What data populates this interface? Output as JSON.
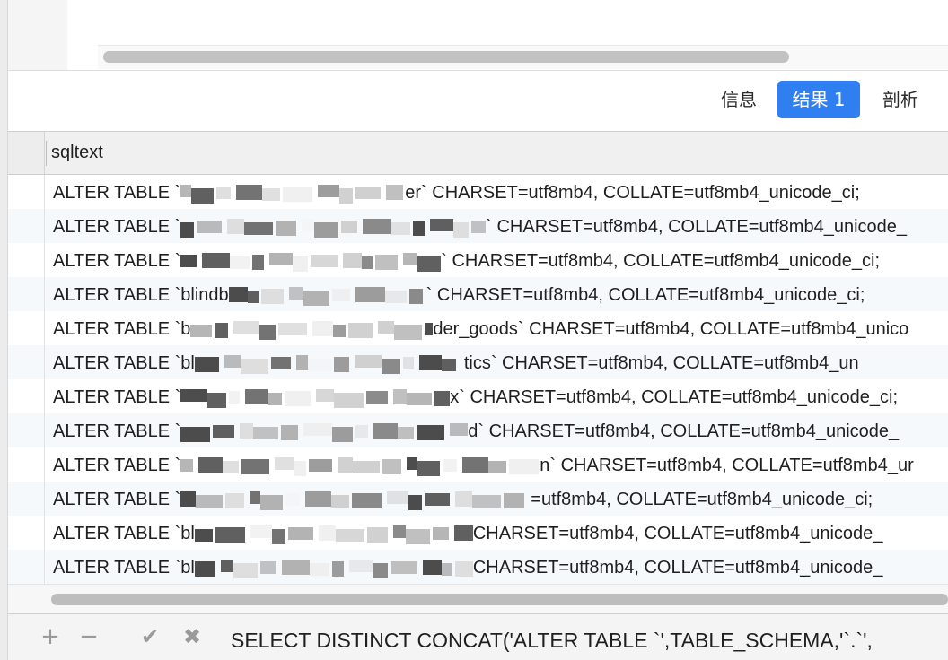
{
  "tabs": {
    "info_label": "信息",
    "result_label": "结果 1",
    "profile_label": "剖析"
  },
  "grid": {
    "column_header": "sqltext",
    "rows": [
      {
        "prefix": "ALTER TABLE `",
        "suffix": "er` CHARSET=utf8mb4, COLLATE=utf8mb4_unicode_ci;"
      },
      {
        "prefix": "ALTER TABLE `",
        "suffix": "` CHARSET=utf8mb4, COLLATE=utf8mb4_unicode_"
      },
      {
        "prefix": "ALTER TABLE `",
        "suffix": "` CHARSET=utf8mb4, COLLATE=utf8mb4_unicode_ci;"
      },
      {
        "prefix": "ALTER TABLE `blindb",
        "suffix": "` CHARSET=utf8mb4, COLLATE=utf8mb4_unicode_ci;"
      },
      {
        "prefix": "ALTER TABLE `b",
        "suffix": "der_goods` CHARSET=utf8mb4, COLLATE=utf8mb4_unico"
      },
      {
        "prefix": "ALTER TABLE `bl",
        "suffix": "tics` CHARSET=utf8mb4, COLLATE=utf8mb4_un"
      },
      {
        "prefix": "ALTER TABLE `",
        "suffix": "x` CHARSET=utf8mb4, COLLATE=utf8mb4_unicode_ci;"
      },
      {
        "prefix": "ALTER TABLE `",
        "suffix": "d` CHARSET=utf8mb4, COLLATE=utf8mb4_unicode_"
      },
      {
        "prefix": "ALTER TABLE `",
        "suffix": "n` CHARSET=utf8mb4, COLLATE=utf8mb4_ur"
      },
      {
        "prefix": "ALTER TABLE `",
        "suffix": "=utf8mb4, COLLATE=utf8mb4_unicode_ci;"
      },
      {
        "prefix": "ALTER TABLE `bl",
        "suffix": "CHARSET=utf8mb4, COLLATE=utf8mb4_unicode_"
      },
      {
        "prefix": "ALTER TABLE `bl",
        "suffix": "CHARSET=utf8mb4, COLLATE=utf8mb4_unicode_"
      }
    ]
  },
  "statusbar": {
    "add_icon": "plus-icon",
    "remove_icon": "minus-icon",
    "apply_icon": "check-icon",
    "discard_icon": "x-icon",
    "query_text": "SELECT DISTINCT CONCAT('ALTER TABLE `',TABLE_SCHEMA,'`.`',"
  },
  "colors": {
    "accent": "#2f7ff0",
    "text": "#1f1f1f",
    "icon_gray": "#9a9a9a"
  }
}
